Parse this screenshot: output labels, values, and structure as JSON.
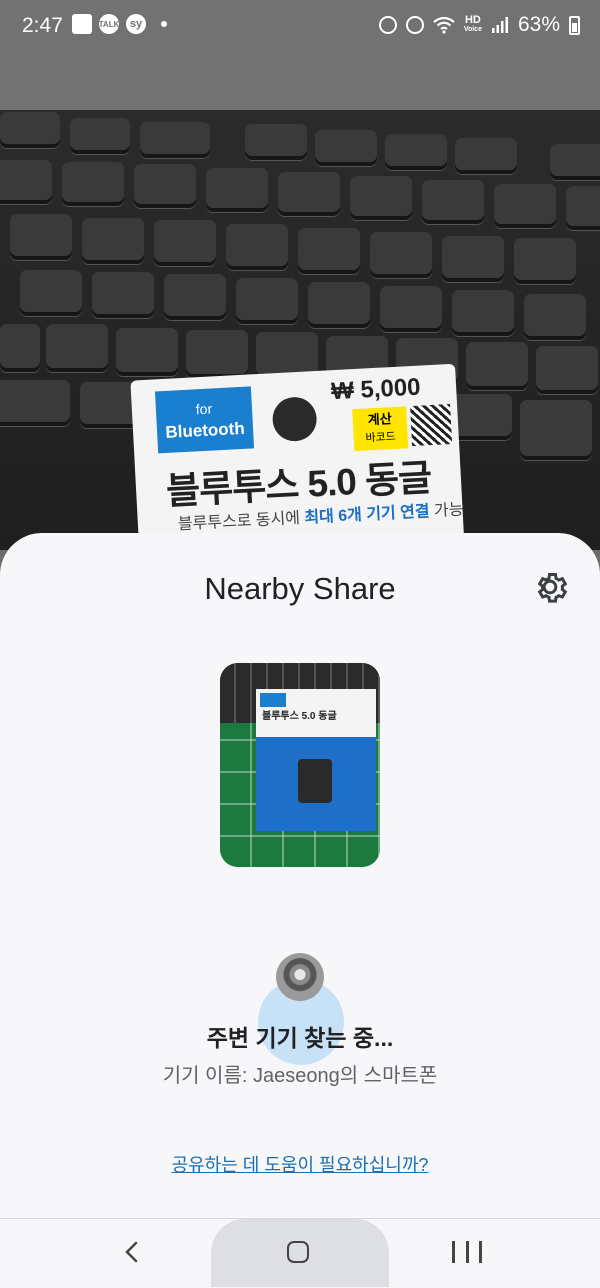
{
  "status_bar": {
    "time": "2:47",
    "left_icons": [
      "gallery-icon",
      "kakaotalk-icon",
      "sy-icon",
      "dot-icon"
    ],
    "kakao_label": "TALK",
    "sy_label": "sy",
    "hd_label": "HD",
    "voice_label": "Voice",
    "battery": "63%"
  },
  "background_photo": {
    "badge_line1": "for",
    "badge_line2": "Bluetooth",
    "price": "₩ 5,000",
    "calc_line1": "계산",
    "calc_line2": "바코드",
    "product_title": "블루투스 5.0 동글",
    "product_sub_prefix": "블루투스로 동시에 ",
    "product_sub_highlight": "최대 6개 기기 연결",
    "product_sub_suffix": " 가능"
  },
  "sheet": {
    "title": "Nearby Share",
    "settings_icon": "gear-icon",
    "thumbnail": {
      "package_title": "블루투스 5.0 동글"
    },
    "status": "주변 기기 찾는 중...",
    "device_name": "기기 이름: Jaeseong의 스마트폰",
    "help_link": "공유하는 데 도움이 필요하십니까?"
  },
  "nav_bar": {
    "back": "back-icon",
    "home": "home-icon",
    "recents": "recent-apps-icon"
  }
}
